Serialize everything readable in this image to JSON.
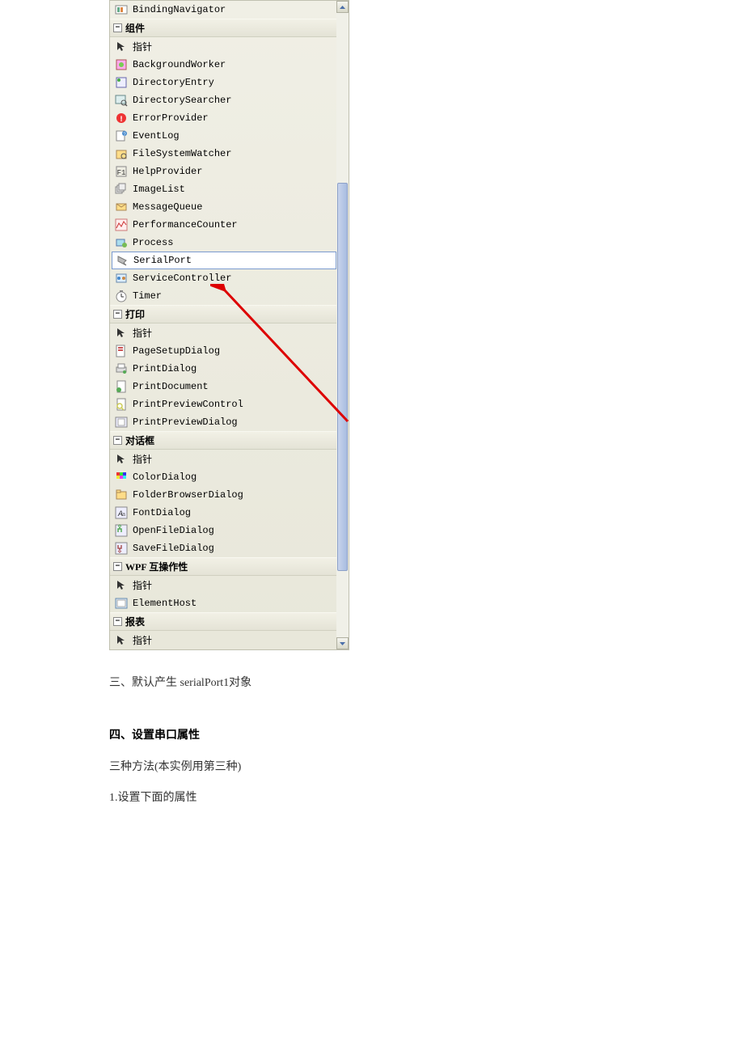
{
  "toolbox": {
    "top_item": "BindingNavigator",
    "categories": [
      {
        "name": "组件",
        "items": [
          {
            "label": "指针",
            "icon": "pointer"
          },
          {
            "label": "BackgroundWorker",
            "icon": "bgworker"
          },
          {
            "label": "DirectoryEntry",
            "icon": "direntry"
          },
          {
            "label": "DirectorySearcher",
            "icon": "dirsearch"
          },
          {
            "label": "ErrorProvider",
            "icon": "error"
          },
          {
            "label": "EventLog",
            "icon": "eventlog"
          },
          {
            "label": "FileSystemWatcher",
            "icon": "fswatcher"
          },
          {
            "label": "HelpProvider",
            "icon": "help"
          },
          {
            "label": "ImageList",
            "icon": "imagelist"
          },
          {
            "label": "MessageQueue",
            "icon": "msgqueue"
          },
          {
            "label": "PerformanceCounter",
            "icon": "perfcounter"
          },
          {
            "label": "Process",
            "icon": "process"
          },
          {
            "label": "SerialPort",
            "icon": "serialport",
            "selected": true
          },
          {
            "label": "ServiceController",
            "icon": "service"
          },
          {
            "label": "Timer",
            "icon": "timer"
          }
        ]
      },
      {
        "name": "打印",
        "items": [
          {
            "label": "指针",
            "icon": "pointer"
          },
          {
            "label": "PageSetupDialog",
            "icon": "pagesetup"
          },
          {
            "label": "PrintDialog",
            "icon": "printdlg"
          },
          {
            "label": "PrintDocument",
            "icon": "printdoc"
          },
          {
            "label": "PrintPreviewControl",
            "icon": "printprev"
          },
          {
            "label": "PrintPreviewDialog",
            "icon": "printprevdlg"
          }
        ]
      },
      {
        "name": "对话框",
        "items": [
          {
            "label": "指针",
            "icon": "pointer"
          },
          {
            "label": "ColorDialog",
            "icon": "colordlg"
          },
          {
            "label": "FolderBrowserDialog",
            "icon": "folderdlg"
          },
          {
            "label": "FontDialog",
            "icon": "fontdlg"
          },
          {
            "label": "OpenFileDialog",
            "icon": "opendlg"
          },
          {
            "label": "SaveFileDialog",
            "icon": "savedlg"
          }
        ]
      },
      {
        "name": "WPF 互操作性",
        "items": [
          {
            "label": "指针",
            "icon": "pointer"
          },
          {
            "label": "ElementHost",
            "icon": "elemhost"
          }
        ]
      },
      {
        "name": "报表",
        "items": [
          {
            "label": "指针",
            "icon": "pointer"
          }
        ]
      }
    ]
  },
  "document": {
    "line1": "三、默认产生 serialPort1对象",
    "line2": "四、设置串口属性",
    "line3": "三种方法(本实例用第三种)",
    "line4": "1.设置下面的属性"
  }
}
